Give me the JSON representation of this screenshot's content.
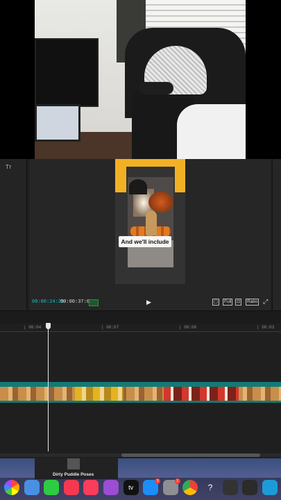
{
  "editor": {
    "left_panel": {
      "text_tool_label": "Tт"
    },
    "preview": {
      "caption": "And we'll include"
    },
    "controls": {
      "time_current": "00:00:24:29",
      "time_total": "00:00:37:02",
      "original_label": "▢",
      "full_label": "Full",
      "crop_label": "⊡",
      "ratio_label": "Ratio",
      "expand_label": "⤢",
      "play_symbol": "▶"
    },
    "timeline": {
      "ticks": [
        "| 00:04",
        "| 00:07",
        "| 00:00",
        "| 00:03"
      ]
    }
  },
  "desktop": {
    "finder_item_label": "Dirty Puddle Poses"
  },
  "dock": {
    "items": [
      {
        "name": "photos",
        "color": "#f2f2f2"
      },
      {
        "name": "messages-bubble",
        "color": "#4a90e2"
      },
      {
        "name": "facetime",
        "color": "#2ecc40"
      },
      {
        "name": "news",
        "color": "#f4394f"
      },
      {
        "name": "music",
        "color": "#fb3c5a"
      },
      {
        "name": "podcasts",
        "color": "#9b4dd4"
      },
      {
        "name": "apple-tv",
        "color": "#111111"
      },
      {
        "name": "app-store",
        "color": "#1c8ef9"
      },
      {
        "name": "system-settings",
        "color": "#8e8e93"
      },
      {
        "name": "chrome",
        "color": "#e9e9e9"
      },
      {
        "name": "help",
        "color": "#777777"
      },
      {
        "name": "screenshot",
        "color": "#333333"
      },
      {
        "name": "obs",
        "color": "#2b2b2b"
      },
      {
        "name": "finder-edge",
        "color": "#1e9bd7"
      }
    ],
    "badges": {
      "app_store": "3",
      "system_settings": "1"
    },
    "tv_label": "tv",
    "help_label": "?"
  }
}
